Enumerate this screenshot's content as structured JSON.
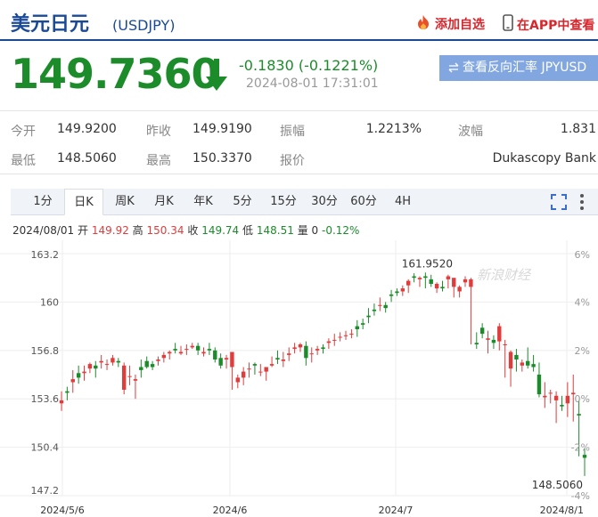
{
  "header": {
    "name": "美元日元",
    "code": "(USDJPY)",
    "add_favorite": "添加自选",
    "app_link": "在APP中查看"
  },
  "quote": {
    "price": "149.7360",
    "change": "-0.1830 (-0.1221%)",
    "timestamp": "2024-08-01 17:31:01",
    "reverse_button": "查看反向汇率 JPYUSD",
    "direction_icon": "down-arrow-icon",
    "color_down": "#1c8c2a",
    "color_up": "#e03c3c"
  },
  "stats": {
    "open_label": "今开",
    "open": "149.9200",
    "prev_close_label": "昨收",
    "prev_close": "149.9190",
    "amplitude_label": "振幅",
    "amplitude": "1.2213%",
    "range_label": "波幅",
    "range": "1.831",
    "low_label": "最低",
    "low": "148.5060",
    "high_label": "最高",
    "high": "150.3370",
    "source_label": "报价",
    "source": "Dukascopy Bank"
  },
  "tabs": [
    "1分",
    "日K",
    "周K",
    "月K",
    "年K",
    "5分",
    "15分",
    "30分",
    "60分",
    "4H"
  ],
  "active_tab": "日K",
  "ohlc_bar": {
    "date": "2024/08/01",
    "open_label": "开",
    "open": "149.92",
    "high_label": "高",
    "high": "150.34",
    "close_label": "收",
    "close": "149.74",
    "low_label": "低",
    "low": "148.51",
    "vol_label": "量",
    "vol": "0",
    "pct": "-0.12%"
  },
  "chart_data": {
    "type": "candlestick",
    "ylim": [
      147.2,
      163.2
    ],
    "y_ticks": [
      "163.2",
      "160",
      "156.8",
      "153.6",
      "150.4",
      "147.2"
    ],
    "pct_ticks": [
      "6%",
      "4%",
      "2%",
      "0%",
      "-2%",
      "-4%"
    ],
    "x_labels": [
      "2024/5/6",
      "2024/6",
      "2024/7",
      "2024/8/1"
    ],
    "max_label": "161.9520",
    "min_label": "148.5060",
    "watermark": "新浪财经",
    "candles": [
      [
        153.3,
        154.1,
        153.5,
        152.8
      ],
      [
        154.1,
        154.4,
        154.0,
        153.5
      ],
      [
        154.7,
        155.5,
        154.9,
        154.0
      ],
      [
        155.3,
        155.8,
        155.0,
        154.6
      ],
      [
        155.3,
        155.8,
        155.4,
        154.8
      ],
      [
        155.6,
        156.0,
        155.9,
        155.3
      ],
      [
        155.8,
        156.1,
        155.6,
        155.0
      ],
      [
        156.0,
        156.5,
        156.1,
        155.6
      ],
      [
        155.9,
        156.2,
        155.9,
        155.5
      ],
      [
        156.0,
        156.5,
        156.3,
        155.8
      ],
      [
        156.1,
        156.3,
        156.0,
        155.7
      ],
      [
        154.2,
        156.0,
        155.8,
        153.9
      ],
      [
        155.1,
        155.8,
        155.1,
        154.5
      ],
      [
        154.8,
        155.2,
        154.9,
        153.6
      ],
      [
        155.7,
        156.2,
        155.5,
        155.0
      ],
      [
        156.1,
        156.4,
        155.7,
        155.6
      ],
      [
        155.9,
        156.1,
        155.7,
        155.5
      ],
      [
        156.1,
        156.4,
        156.2,
        155.8
      ],
      [
        156.3,
        156.7,
        156.5,
        156.0
      ],
      [
        156.6,
        156.8,
        156.7,
        156.2
      ],
      [
        156.9,
        157.3,
        156.8,
        156.6
      ],
      [
        156.6,
        157.1,
        156.7,
        156.5
      ],
      [
        156.9,
        157.2,
        156.9,
        156.5
      ],
      [
        157.0,
        157.3,
        157.1,
        156.9
      ],
      [
        157.1,
        157.3,
        156.8,
        156.5
      ],
      [
        156.6,
        157.0,
        156.7,
        156.4
      ],
      [
        156.9,
        157.3,
        156.8,
        156.5
      ],
      [
        156.8,
        157.0,
        156.2,
        156.0
      ],
      [
        156.3,
        156.6,
        155.8,
        155.6
      ],
      [
        156.2,
        156.5,
        156.3,
        155.6
      ],
      [
        155.7,
        156.7,
        156.7,
        154.2
      ],
      [
        154.7,
        155.2,
        155.0,
        154.3
      ],
      [
        155.0,
        155.7,
        155.4,
        154.5
      ],
      [
        155.6,
        156.0,
        155.6,
        155.0
      ],
      [
        155.9,
        156.0,
        155.8,
        155.2
      ],
      [
        155.4,
        155.9,
        155.4,
        155.1
      ],
      [
        155.4,
        155.7,
        155.7,
        154.8
      ],
      [
        155.8,
        156.4,
        155.9,
        155.7
      ],
      [
        156.3,
        156.8,
        156.2,
        155.9
      ],
      [
        156.1,
        156.7,
        156.2,
        155.7
      ],
      [
        156.5,
        157.0,
        156.6,
        156.1
      ],
      [
        156.9,
        157.3,
        157.0,
        156.6
      ],
      [
        157.0,
        157.3,
        157.2,
        156.7
      ],
      [
        157.1,
        157.4,
        156.3,
        155.8
      ],
      [
        156.6,
        157.0,
        156.6,
        156.0
      ],
      [
        156.8,
        157.1,
        156.9,
        156.5
      ],
      [
        157.0,
        157.2,
        156.9,
        156.6
      ],
      [
        157.3,
        157.6,
        157.4,
        156.9
      ],
      [
        157.5,
        157.9,
        157.5,
        157.1
      ],
      [
        157.7,
        158.0,
        157.7,
        157.4
      ],
      [
        157.8,
        158.1,
        157.8,
        157.5
      ],
      [
        157.9,
        158.2,
        157.9,
        157.6
      ],
      [
        158.4,
        158.8,
        158.2,
        157.7
      ],
      [
        158.6,
        158.9,
        158.5,
        158.2
      ],
      [
        159.1,
        159.6,
        159.0,
        158.6
      ],
      [
        159.5,
        159.9,
        159.4,
        159.1
      ],
      [
        159.8,
        160.3,
        159.8,
        159.4
      ],
      [
        159.8,
        160.0,
        159.6,
        159.3
      ],
      [
        160.5,
        160.8,
        160.4,
        160.0
      ],
      [
        160.7,
        160.9,
        160.6,
        160.4
      ],
      [
        160.7,
        161.1,
        160.9,
        160.4
      ],
      [
        161.1,
        161.5,
        161.4,
        160.6
      ],
      [
        161.7,
        161.9,
        161.6,
        161.3
      ],
      [
        161.5,
        161.7,
        161.6,
        161.0
      ],
      [
        161.7,
        161.95,
        161.6,
        160.9
      ],
      [
        161.5,
        161.8,
        161.2,
        161.0
      ],
      [
        160.9,
        161.3,
        161.2,
        160.6
      ],
      [
        161.0,
        161.4,
        160.9,
        160.7
      ],
      [
        161.5,
        161.8,
        161.7,
        160.9
      ],
      [
        161.0,
        161.4,
        161.6,
        160.3
      ],
      [
        160.7,
        161.1,
        161.0,
        160.3
      ],
      [
        161.3,
        161.7,
        161.5,
        161.0
      ],
      [
        161.0,
        161.6,
        161.5,
        157.2
      ],
      [
        157.3,
        158.0,
        157.2,
        156.9
      ],
      [
        158.3,
        158.6,
        157.9,
        157.6
      ],
      [
        157.5,
        158.1,
        157.6,
        156.6
      ],
      [
        157.5,
        157.8,
        157.3,
        156.9
      ],
      [
        157.4,
        158.6,
        158.4,
        156.8
      ],
      [
        157.2,
        157.5,
        157.2,
        155.0
      ],
      [
        155.6,
        156.8,
        156.7,
        154.4
      ],
      [
        156.5,
        156.9,
        156.2,
        155.4
      ],
      [
        155.8,
        156.2,
        156.0,
        155.4
      ],
      [
        156.1,
        157.0,
        155.8,
        155.6
      ],
      [
        155.9,
        156.5,
        155.7,
        155.4
      ],
      [
        155.2,
        156.0,
        153.9,
        153.7
      ],
      [
        153.7,
        154.7,
        153.8,
        153.0
      ],
      [
        154.0,
        154.2,
        154.0,
        153.3
      ],
      [
        153.5,
        154.1,
        153.8,
        152.0
      ],
      [
        153.2,
        153.8,
        153.1,
        152.8
      ],
      [
        153.3,
        154.7,
        153.8,
        152.4
      ],
      [
        153.9,
        155.2,
        154.0,
        152.1
      ],
      [
        152.6,
        153.5,
        152.5,
        149.8
      ],
      [
        149.9,
        150.3,
        149.7,
        148.5
      ]
    ]
  }
}
